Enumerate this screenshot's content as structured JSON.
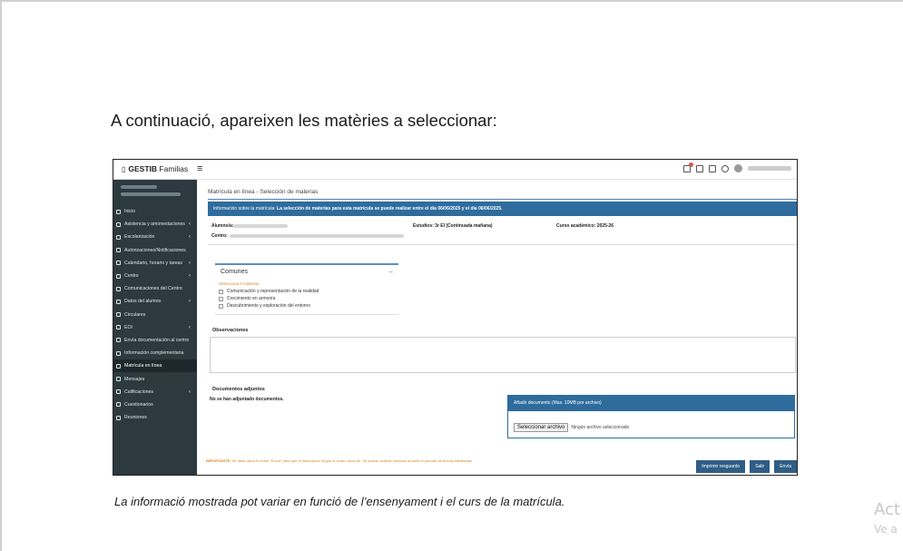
{
  "document": {
    "heading": "A continuació, apareixen les matèries a seleccionar:",
    "caption": "La informació mostrada pot variar en funció de l’ensenyament i el curs de la matrícula.",
    "watermark_line1": "Act",
    "watermark_line2": "Ve a"
  },
  "app": {
    "logo_bold": "GESTIB",
    "logo_rest": " Familias",
    "menu_glyph": "≡"
  },
  "sidebar": {
    "items": [
      {
        "label": "Inicio",
        "chevron": false,
        "active": false
      },
      {
        "label": "Asistencia y amonestaciones",
        "chevron": true,
        "active": false
      },
      {
        "label": "Escolarización",
        "chevron": true,
        "active": false
      },
      {
        "label": "Autorizaciones/Notificaciones",
        "chevron": false,
        "active": false
      },
      {
        "label": "Calendario, horario y tareas",
        "chevron": true,
        "active": false
      },
      {
        "label": "Centro",
        "chevron": true,
        "active": false
      },
      {
        "label": "Comunicaciones del Centro",
        "chevron": false,
        "active": false
      },
      {
        "label": "Datos del alumno",
        "chevron": true,
        "active": false
      },
      {
        "label": "Circulares",
        "chevron": false,
        "active": false
      },
      {
        "label": "EOI",
        "chevron": true,
        "active": false
      },
      {
        "label": "Envía documentación al centro",
        "chevron": false,
        "active": false
      },
      {
        "label": "Información complementaria",
        "chevron": false,
        "active": false
      },
      {
        "label": "Matrícula en línea",
        "chevron": false,
        "active": true
      },
      {
        "label": "Mensajes",
        "chevron": false,
        "active": false
      },
      {
        "label": "Calificaciones",
        "chevron": true,
        "active": false
      },
      {
        "label": "Cuestionarios",
        "chevron": false,
        "active": false
      },
      {
        "label": "Reuniones",
        "chevron": false,
        "active": false
      }
    ]
  },
  "main": {
    "breadcrumb": "Matrícula en línea - Selección de materias",
    "info_prefix": "Información sobre la matrícula: ",
    "info_bold": "La selección de materias para esta matrícula se puede realizar entre el día 06/06/2025 y el día 06/06/2025.",
    "alumno_label": "Alumno/a:",
    "centro_label": "Centro:",
    "estudios": "Estudios: 3r EI (Continuada mañana)",
    "curso": "Curso académico: 2025-26",
    "comunes_title": "Comunes",
    "comunes_toggle": "–",
    "comunes_sub": "Selecciona 3 materias",
    "subjects": [
      "Comunicación y representación de la realidad",
      "Crecimiento en armonía",
      "Descubrimiento y exploración del entorno"
    ],
    "observaciones_label": "Observaciones",
    "docs_label": "Documentos adjuntos",
    "docs_none": "No se han adjuntado documentos.",
    "upload_header": "Añadir documento (Max. 10MB por archivo)",
    "file_button": "Seleccionar archivo",
    "file_none": "Ningún archivo seleccionado",
    "important_bold": "IMPORTANTE:",
    "important_text": " Se debe clicar el botón \"Envía\" para que la información llegue al centro docente. Se podrán realizar cambios durante el periodo de fechas habilitadas.",
    "buttons": {
      "print": "Imprimir resguardo",
      "exit": "Salir",
      "send": "Envía"
    }
  }
}
